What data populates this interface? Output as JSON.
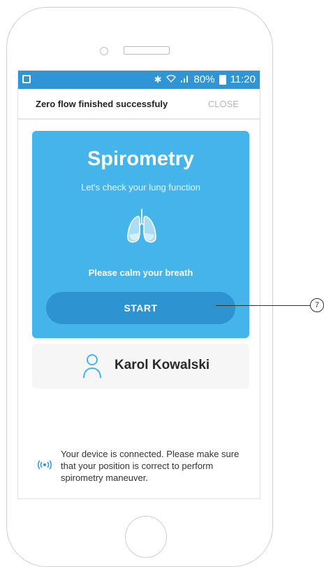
{
  "status_bar": {
    "battery": "80%",
    "time": "11:20",
    "icons": [
      "image-icon",
      "bluetooth-icon",
      "wifi-icon",
      "signal-icon",
      "battery-icon"
    ]
  },
  "toast": {
    "message": "Zero flow finished successfuly",
    "close_label": "CLOSE"
  },
  "card": {
    "title": "Spirometry",
    "subtitle": "Let's check your lung function",
    "icon": "lungs-icon",
    "instruction": "Please calm your breath",
    "start_label": "START",
    "background": "#45b4ea",
    "button_color": "#2d93d1"
  },
  "user": {
    "name": "Karol Kowalski",
    "icon": "person-icon"
  },
  "connection": {
    "icon": "connection-signal-icon",
    "text": "Your device is connected. Please make sure that your position is correct to perform spirometry maneuver."
  },
  "callout": {
    "number": "7"
  },
  "colors": {
    "status_bar": "#2f95d6",
    "accent": "#45b4ea",
    "connection_icon": "#2f95d6"
  }
}
